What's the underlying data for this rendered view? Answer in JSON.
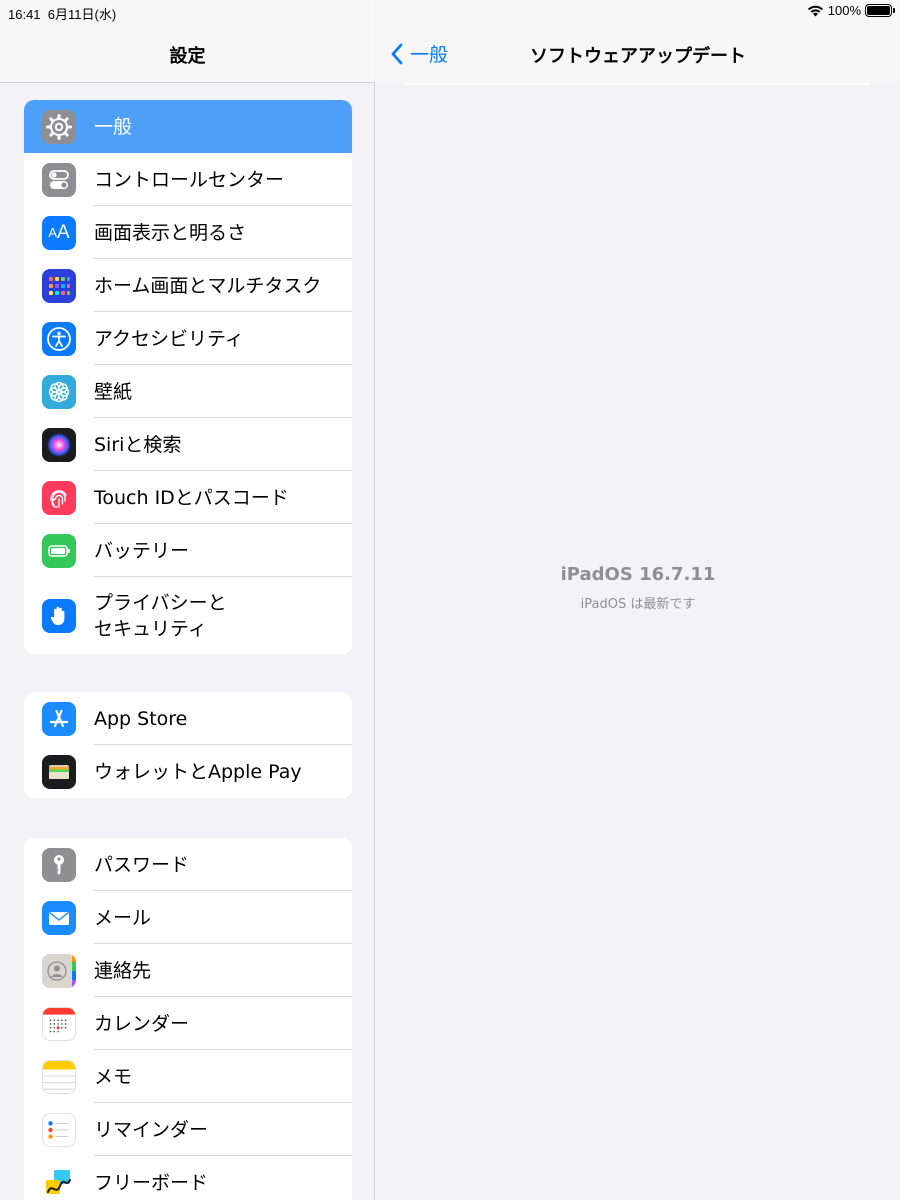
{
  "status_bar": {
    "time": "16:41",
    "date": "6月11日(水)",
    "battery": "100%"
  },
  "sidebar": {
    "title": "設定",
    "groups": [
      {
        "items": [
          {
            "label": "一般",
            "icon": "gear-icon",
            "color": "#8e8e93",
            "selected": true
          },
          {
            "label": "コントロールセンター",
            "icon": "toggles-icon",
            "color": "#8e8e93"
          },
          {
            "label": "画面表示と明るさ",
            "icon": "text-size-icon",
            "color": "#0a7aff"
          },
          {
            "label": "ホーム画面とマルチタスク",
            "icon": "home-grid-icon",
            "color": "#2c3fd9"
          },
          {
            "label": "アクセシビリティ",
            "icon": "accessibility-icon",
            "color": "#0a7aff"
          },
          {
            "label": "壁紙",
            "icon": "flower-icon",
            "color": "#34aadc"
          },
          {
            "label": "Siriと検索",
            "icon": "siri-icon",
            "color": "#1c1c1e"
          },
          {
            "label": "Touch IDとパスコード",
            "icon": "fingerprint-icon",
            "color": "#ff3b5c"
          },
          {
            "label": "バッテリー",
            "icon": "battery-icon",
            "color": "#34c759"
          },
          {
            "label": "プライバシーと\nセキュリティ",
            "icon": "hand-icon",
            "color": "#0a7aff"
          }
        ]
      },
      {
        "items": [
          {
            "label": "App Store",
            "icon": "app-store-icon",
            "color": "#1a8cff"
          },
          {
            "label": "ウォレットとApple Pay",
            "icon": "wallet-icon",
            "color": "#1c1c1e"
          }
        ]
      },
      {
        "items": [
          {
            "label": "パスワード",
            "icon": "key-icon",
            "color": "#8e8e93"
          },
          {
            "label": "メール",
            "icon": "mail-icon",
            "color": "#1a8cff"
          },
          {
            "label": "連絡先",
            "icon": "contacts-icon",
            "color": "#d8d8d8"
          },
          {
            "label": "カレンダー",
            "icon": "calendar-icon",
            "color": "#ffffff"
          },
          {
            "label": "メモ",
            "icon": "notes-icon",
            "color": "#ffffff"
          },
          {
            "label": "リマインダー",
            "icon": "reminders-icon",
            "color": "#ffffff"
          },
          {
            "label": "フリーボード",
            "icon": "freeform-icon",
            "color": "#ffffff"
          }
        ]
      }
    ]
  },
  "detail": {
    "back_label": "一般",
    "title": "ソフトウェアアップデート",
    "version": "iPadOS 16.7.11",
    "status": "iPadOS は最新です"
  }
}
